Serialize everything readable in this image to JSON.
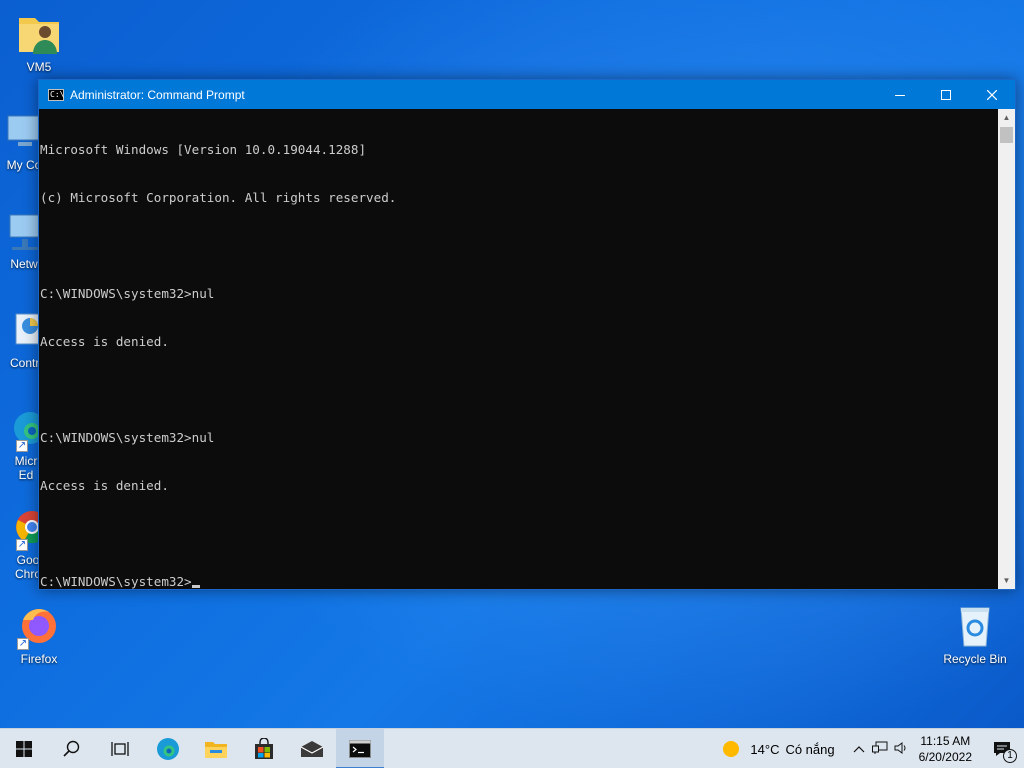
{
  "desktop": {
    "icons": [
      {
        "label": "VM5",
        "icon": "user-folder-icon"
      },
      {
        "label": "My Co",
        "icon": "computer-icon"
      },
      {
        "label": "Netw",
        "icon": "network-icon"
      },
      {
        "label": "Contro",
        "icon": "control-panel-icon"
      },
      {
        "label": "Micr\nEd",
        "icon": "edge-icon"
      },
      {
        "label": "Goo\nChro",
        "icon": "chrome-icon"
      },
      {
        "label": "Firefox",
        "icon": "firefox-icon"
      },
      {
        "label": "Recycle Bin",
        "icon": "recycle-bin-icon"
      }
    ]
  },
  "window": {
    "title": "Administrator: Command Prompt",
    "controls": {
      "minimize": "minimize-icon",
      "maximize": "maximize-icon",
      "close": "close-icon"
    },
    "terminal_lines": [
      "Microsoft Windows [Version 10.0.19044.1288]",
      "(c) Microsoft Corporation. All rights reserved.",
      "",
      "C:\\WINDOWS\\system32>nul",
      "Access is denied.",
      "",
      "C:\\WINDOWS\\system32>nul",
      "Access is denied.",
      "",
      "C:\\WINDOWS\\system32>"
    ]
  },
  "taskbar": {
    "buttons": [
      "start-icon",
      "search-icon",
      "task-view-icon",
      "edge-icon",
      "file-explorer-icon",
      "store-icon",
      "mail-icon",
      "cmd-icon"
    ],
    "active": "cmd-icon",
    "weather": {
      "temp": "14°C",
      "condition": "Có nắng"
    },
    "time": "11:15 AM",
    "date": "6/20/2022",
    "notifications": "1"
  },
  "colors": {
    "titlebar": "#0078d7",
    "terminal_bg": "#0c0c0c",
    "terminal_fg": "#cccccc",
    "taskbar": "#dde6ef"
  }
}
